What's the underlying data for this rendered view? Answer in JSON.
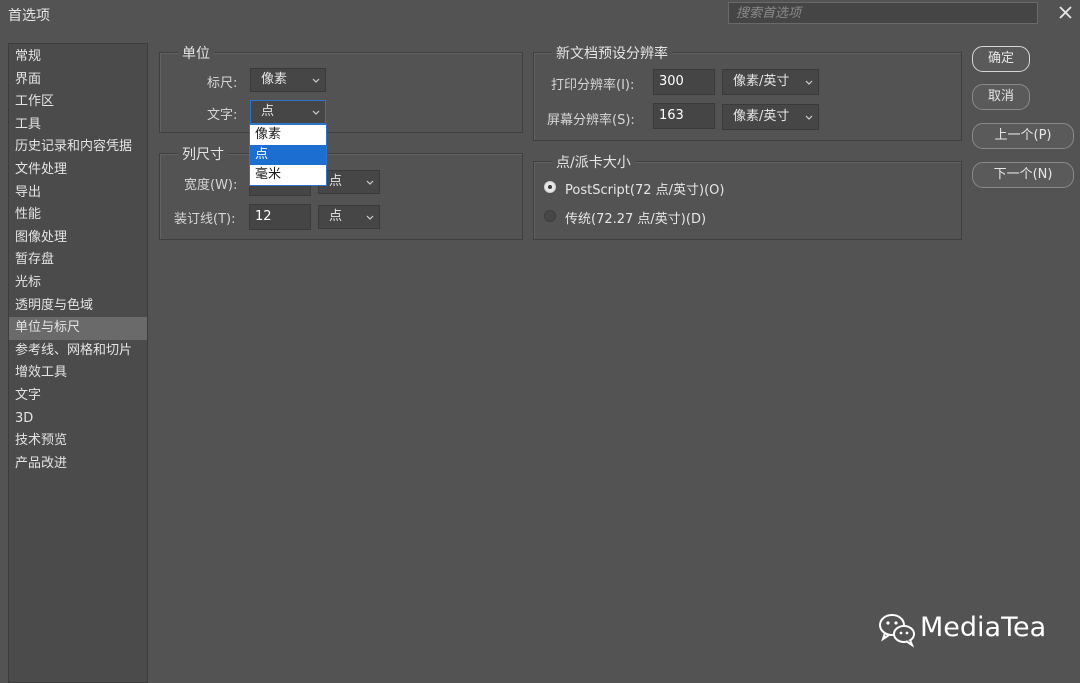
{
  "window": {
    "title": "首选项",
    "search_placeholder": "搜索首选项"
  },
  "sidebar": {
    "items": [
      "常规",
      "界面",
      "工作区",
      "工具",
      "历史记录和内容凭据",
      "文件处理",
      "导出",
      "性能",
      "图像处理",
      "暂存盘",
      "光标",
      "透明度与色域",
      "单位与标尺",
      "参考线、网格和切片",
      "增效工具",
      "文字",
      "3D",
      "技术预览",
      "产品改进"
    ],
    "selected": "单位与标尺"
  },
  "units": {
    "legend": "单位",
    "ruler_label": "标尺:",
    "ruler_value": "像素",
    "type_label": "文字:",
    "type_value": "点",
    "type_options": [
      "像素",
      "点",
      "毫米"
    ],
    "type_highlighted": "点"
  },
  "column": {
    "legend": "列尺寸",
    "width_label": "宽度(W):",
    "width_unit": "点",
    "gutter_label": "装订线(T):",
    "gutter_value": "12",
    "gutter_unit": "点"
  },
  "resolution": {
    "legend": "新文档预设分辨率",
    "print_label": "打印分辨率(I):",
    "print_value": "300",
    "print_unit": "像素/英寸",
    "screen_label": "屏幕分辨率(S):",
    "screen_value": "163",
    "screen_unit": "像素/英寸"
  },
  "pica": {
    "legend": "点/派卡大小",
    "postscript_label": "PostScript(72 点/英寸)(O)",
    "traditional_label": "传统(72.27 点/英寸)(D)",
    "selected": "postscript"
  },
  "buttons": {
    "ok": "确定",
    "cancel": "取消",
    "prev": "上一个(P)",
    "next": "下一个(N)"
  },
  "watermark": {
    "text": "MediaTea"
  }
}
